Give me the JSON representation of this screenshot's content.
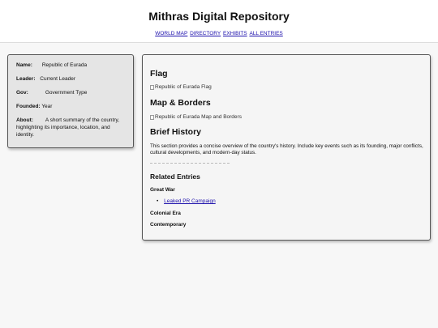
{
  "header": {
    "title": "Mithras Digital Repository",
    "nav": [
      "WORLD MAP",
      "DIRECTORY",
      "EXHIBITS",
      "ALL ENTRIES"
    ]
  },
  "infobox": {
    "name_label": "Name:",
    "name_value": "Republic of Eurada",
    "leader_label": "Leader:",
    "leader_value": "Current Leader",
    "gov_label": "Gov:",
    "gov_value": "Government Type",
    "founded_label": "Founded:",
    "founded_value": "Year",
    "about_label": "About:",
    "about_value": "A short summary of the country, highlighting its importance, location, and identity."
  },
  "main": {
    "flag_heading": "Flag",
    "flag_alt": "Republic of Eurada Flag",
    "map_heading": "Map & Borders",
    "map_alt": "Republic of Eurada Map and Borders",
    "history_heading": "Brief History",
    "history_text": "This section provides a concise overview of the country's history. Include key events such as its founding, major conflicts, cultural developments, and modern-day status.",
    "related_heading": "Related Entries",
    "eras": [
      {
        "name": "Great War",
        "links": [
          "Leaked PR Campaign"
        ]
      },
      {
        "name": "Colonial Era",
        "links": []
      },
      {
        "name": "Contemporary",
        "links": []
      }
    ]
  },
  "colors": {
    "link": "#1a0dab",
    "infobox_bg": "#e5e5e5",
    "page_bg": "#f7f7f7"
  }
}
